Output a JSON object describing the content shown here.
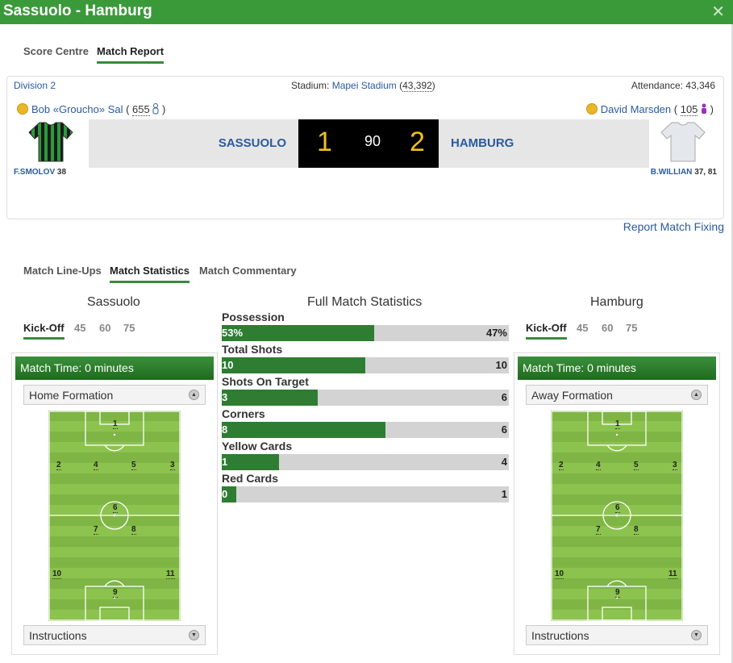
{
  "window": {
    "title": "Sassuolo - Hamburg",
    "close": "✕"
  },
  "top_tabs": [
    "Score Centre",
    "Match Report"
  ],
  "match": {
    "division": "Division 2",
    "stadium_label": "Stadium:",
    "stadium_name": "Mapei Stadium",
    "capacity": "43,392",
    "attendance": "Attendance: 43,346",
    "home_manager": "Bob «Groucho» Sal",
    "home_manager_rating": "655",
    "away_manager": "David Marsden",
    "away_manager_rating": "105",
    "home_team": "SASSUOLO",
    "away_team": "HAMBURG",
    "home_score": "1",
    "away_score": "2",
    "minute": "90",
    "home_scorer": "F.SMOLOV",
    "home_scorer_min": "38",
    "away_scorer": "B.WILLIAN",
    "away_scorer_min": "37, 81",
    "report_fixing": "Report Match Fixing"
  },
  "sub_tabs": [
    "Match Line-Ups",
    "Match Statistics",
    "Match Commentary"
  ],
  "home": {
    "name": "Sassuolo",
    "kickoff_tabs": [
      "Kick-Off",
      "45",
      "60",
      "75"
    ],
    "match_time": "Match Time: 0 minutes",
    "formation_label": "Home Formation",
    "instructions": "Instructions",
    "positions": [
      "1",
      "2",
      "4",
      "5",
      "3",
      "6",
      "7",
      "8",
      "10",
      "11",
      "9"
    ]
  },
  "away": {
    "name": "Hamburg",
    "kickoff_tabs": [
      "Kick-Off",
      "45",
      "60",
      "75"
    ],
    "match_time": "Match Time: 0 minutes",
    "formation_label": "Away Formation",
    "instructions": "Instructions",
    "positions": [
      "1",
      "2",
      "4",
      "5",
      "3",
      "6",
      "7",
      "8",
      "10",
      "11",
      "9"
    ]
  },
  "stats": {
    "title": "Full Match Statistics",
    "rows": [
      {
        "label": "Possession",
        "home": "53%",
        "away": "47%",
        "home_share": 0.53
      },
      {
        "label": "Total Shots",
        "home": "10",
        "away": "10",
        "home_share": 0.5
      },
      {
        "label": "Shots On Target",
        "home": "3",
        "away": "6",
        "home_share": 0.333
      },
      {
        "label": "Corners",
        "home": "8",
        "away": "6",
        "home_share": 0.571
      },
      {
        "label": "Yellow Cards",
        "home": "1",
        "away": "4",
        "home_share": 0.2
      },
      {
        "label": "Red Cards",
        "home": "0",
        "away": "1",
        "home_share": 0.05
      }
    ]
  },
  "colors": {
    "brand": "#3a9a3a",
    "bar_fill": "#2e7d32",
    "bar_bg": "#d3d3d3",
    "score": "#f0c020",
    "link": "#2a5a9e"
  }
}
